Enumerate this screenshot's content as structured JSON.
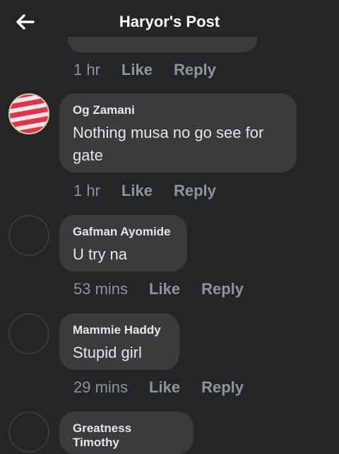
{
  "header": {
    "title": "Haryor's Post",
    "back_icon": "arrow-left-icon"
  },
  "comments": [
    {
      "time": "1 hr",
      "like": "Like",
      "reply": "Reply"
    },
    {
      "author": "Og Zamani",
      "text": "Nothing musa no go see for gate",
      "time": "1 hr",
      "like": "Like",
      "reply": "Reply"
    },
    {
      "author": "Gafman Ayomide",
      "text": "U try na",
      "time": "53 mins",
      "like": "Like",
      "reply": "Reply"
    },
    {
      "author": "Mammie Haddy",
      "text": "Stupid girl",
      "time": "29 mins",
      "like": "Like",
      "reply": "Reply"
    },
    {
      "author": "Greatness Timothy"
    }
  ]
}
